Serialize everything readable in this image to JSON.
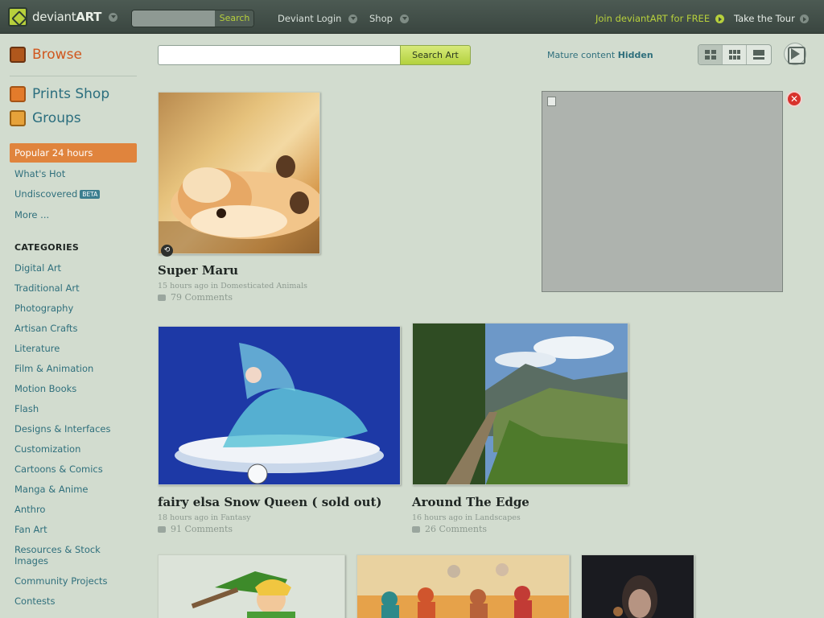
{
  "topbar": {
    "logo_text_a": "deviant",
    "logo_text_b": "ART",
    "search_button": "Search",
    "links": [
      "Deviant Login",
      "Shop"
    ],
    "join": "Join deviantART for FREE",
    "tour": "Take the Tour"
  },
  "sidebar": {
    "browse": "Browse",
    "prints_shop": "Prints Shop",
    "groups": "Groups",
    "nav": {
      "popular": "Popular 24 hours",
      "hot": "What's Hot",
      "undiscovered": "Undiscovered",
      "beta": "BETA",
      "more": "More ..."
    },
    "categories_heading": "CATEGORIES",
    "categories": [
      "Digital Art",
      "Traditional Art",
      "Photography",
      "Artisan Crafts",
      "Literature",
      "Film & Animation",
      "Motion Books",
      "Flash",
      "Designs & Interfaces",
      "Customization",
      "Cartoons & Comics",
      "Manga & Anime",
      "Anthro",
      "Fan Art",
      "Resources & Stock Images",
      "Community Projects",
      "Contests"
    ]
  },
  "main": {
    "search_button": "Search Art",
    "mature_label": "Mature content",
    "mature_value": "Hidden",
    "deviations": [
      {
        "title": "Super Maru",
        "meta": "15 hours ago in Domesticated Animals",
        "comments": "79 Comments"
      },
      {
        "title": "fairy elsa Snow Queen ( sold out)",
        "meta": "18 hours ago in Fantasy",
        "comments": "91 Comments"
      },
      {
        "title": "Around The Edge",
        "meta": "16 hours ago in Landscapes",
        "comments": "26 Comments"
      }
    ]
  },
  "colors": {
    "accent_green": "#b7d03c",
    "browse_orange": "#d0571e",
    "popular_bg": "#e0843d",
    "link_teal": "#2f6f7c"
  }
}
